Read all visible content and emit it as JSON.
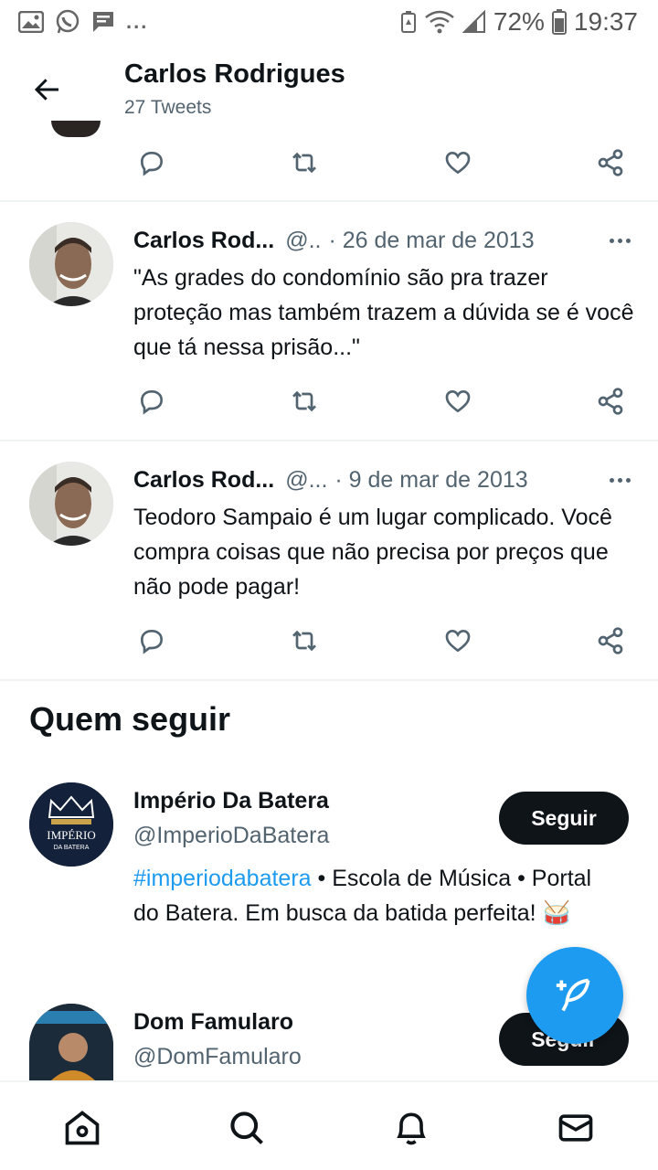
{
  "status_bar": {
    "battery": "72%",
    "time": "19:37",
    "overflow": "..."
  },
  "header": {
    "title": "Carlos Rodrigues",
    "subtitle": "27 Tweets"
  },
  "tweets": [
    {
      "name": "Carlos Rod...",
      "handle": "@..",
      "date": "· 26 de mar de 2013",
      "text": "\"As grades do condomínio são pra trazer proteção mas também trazem a dúvida se é você que tá nessa prisão...\""
    },
    {
      "name": "Carlos Rod...",
      "handle": "@...",
      "date": "· 9 de mar de 2013",
      "text": "Teodoro Sampaio é um lugar complicado. Você compra coisas que não precisa por preços que não pode pagar!"
    }
  ],
  "who_to_follow": {
    "title": "Quem seguir",
    "accounts": [
      {
        "name": "Império Da Batera",
        "handle": "@ImperioDaBatera",
        "bio_hashtag": "#imperiodabatera",
        "bio_rest": " • Escola de Música • Portal do Batera. Em busca da batida perfeita! 🥁",
        "button": "Seguir",
        "logo_text": "IMPÉRIO",
        "logo_subtext": "DA BATERA"
      },
      {
        "name": "Dom Famularo",
        "handle": "@DomFamularo",
        "button": "Seguir"
      }
    ]
  },
  "colors": {
    "accent": "#1d9bf0",
    "text": "#0f1419",
    "secondary": "#536471",
    "button_bg": "#0f1419"
  }
}
